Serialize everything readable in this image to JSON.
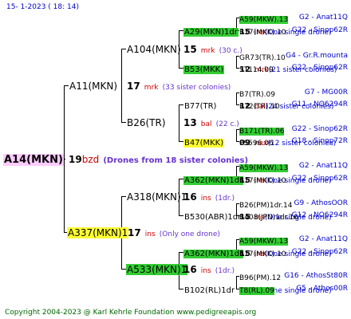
{
  "header": {
    "text": "15-   1-2023 (  18:  14)"
  },
  "footer": {
    "text": "Copyright 2004-2023 @ Karl Kehrle Foundation    www.pedigreeapis.org"
  },
  "root": {
    "name": "A14(MKN)",
    "year": "19",
    "code": "bzd",
    "note": "(Drones from 18 sister colonies)"
  },
  "gen1": [
    {
      "id": "g1a",
      "name": "A11(MKN)",
      "year": "17",
      "code": "mrk",
      "note": "(33 sister colonies)"
    },
    {
      "id": "g1b",
      "name": "A337(MKN)1",
      "year": "17",
      "code": "ins",
      "note": "(Only one drone)"
    }
  ],
  "gen2": [
    {
      "id": "g2a",
      "name": "A104(MKN)",
      "year": "15",
      "code": "mrk",
      "note": "(30 c.)"
    },
    {
      "id": "g2b",
      "name": "B26(TR)",
      "year": "13",
      "code": "bal",
      "note": "(22 c.)"
    },
    {
      "id": "g2c",
      "name": "A318(MKN)1",
      "year": "16",
      "code": "ins",
      "note": "(1dr.)"
    },
    {
      "id": "g2d",
      "name": "A533(MKN)1",
      "year": "16",
      "code": "ins",
      "note": "(1dr.)"
    }
  ],
  "gen3": [
    {
      "id": "g3a",
      "name": "A29(MKN)1dr",
      "year": "15",
      "code": "ins",
      "note": "(One single drone)"
    },
    {
      "id": "g3b",
      "name": "B53(MKK)",
      "year": "12",
      "code": "mrk",
      "note": "(21 sister colonies)"
    },
    {
      "id": "g3c",
      "name": "B77(TR)",
      "year": "12",
      "code": "bal",
      "note": "(24 sister colonies)"
    },
    {
      "id": "g3d",
      "name": "B47(MKK)",
      "year": "09",
      "code": "nex",
      "note": "(12 sister colonies)"
    },
    {
      "id": "g3e",
      "name": "A362(MKN)1dr",
      "year": "15",
      "code": "ins",
      "note": "(One single drone)"
    },
    {
      "id": "g3f",
      "name": "B530(ABR)1dr",
      "year": "15",
      "code": "ins",
      "note": "(One single drone)"
    },
    {
      "id": "g3g",
      "name": "A362(MKN)1dr",
      "year": "15",
      "code": "ins",
      "note": "(One single drone)"
    },
    {
      "id": "g3h",
      "name": "B102(RL)1dr",
      "year": "14",
      "code": "ins",
      "note": "(One single drone)"
    }
  ],
  "gen4": [
    {
      "name": "A59(MKW).13",
      "ref": "G2 - Anat11Q"
    },
    {
      "name": "B17(MKK).10",
      "ref": "G22 - Sinop62R"
    },
    {
      "name": "GR73(TR).10",
      "ref": "G4 - Gr.R.mounta"
    },
    {
      "name": "ST114.09",
      "ref": "G22 - Sinop62R"
    },
    {
      "name": "B7(TR).09",
      "ref": "G7 - MG00R"
    },
    {
      "name": "B72(TR).10",
      "ref": "G11 - NO6294R"
    },
    {
      "name": "B171(TR).06",
      "ref": "G22 - Sinop62R"
    },
    {
      "name": "PS596.06",
      "ref": "G18 - Sinop72R"
    },
    {
      "name": "A59(MKW).13",
      "ref": "G2 - Anat11Q"
    },
    {
      "name": "B17(MKK).10",
      "ref": "G22 - Sinop62R"
    },
    {
      "name": "B26(PM)1dr.14",
      "ref": "G9 - AthosOOR"
    },
    {
      "name": "B408(JPN)1dr.16",
      "ref": "G12 - NO6294R"
    },
    {
      "name": "A59(MKW).13",
      "ref": "G2 - Anat11Q"
    },
    {
      "name": "B17(MKK).10",
      "ref": "G22 - Sinop62R"
    },
    {
      "name": "B96(PM).12",
      "ref": "G16 - AthosSt80R"
    },
    {
      "name": "T8(RL).09",
      "ref": "G5 - Athos00R"
    }
  ]
}
